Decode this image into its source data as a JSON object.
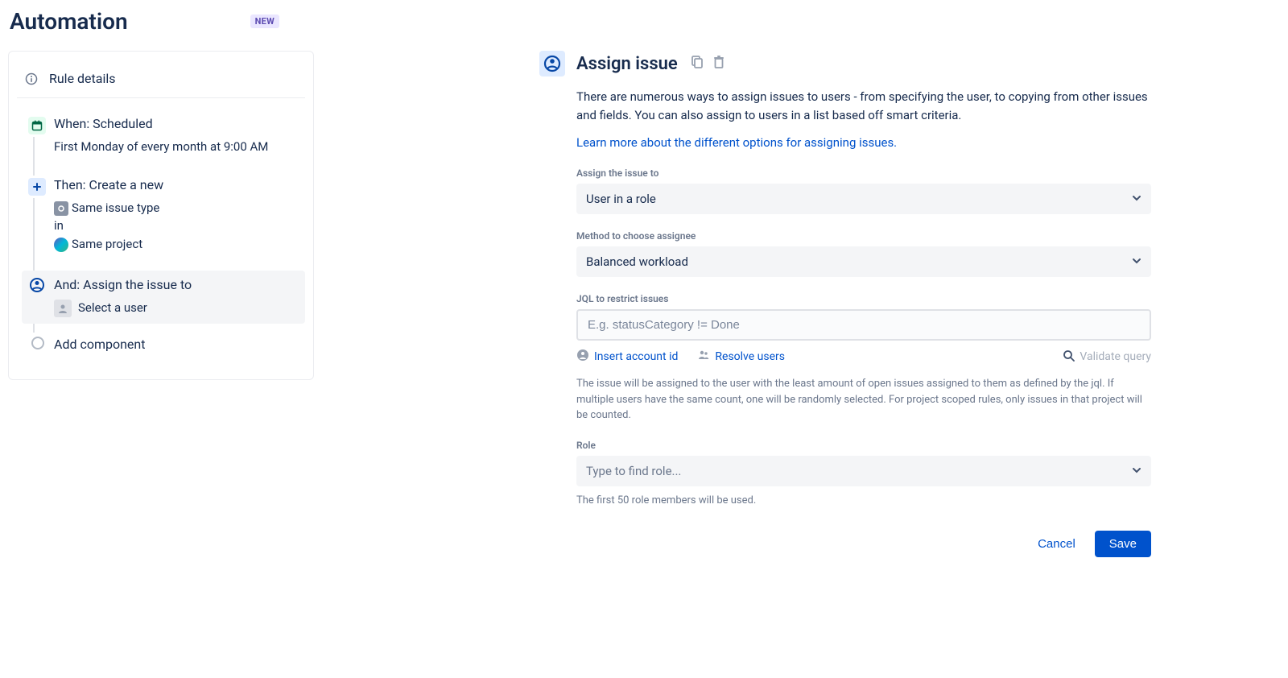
{
  "header": {
    "title": "Automation",
    "badge": "NEW"
  },
  "sidebar": {
    "rule_details": "Rule details",
    "trigger": {
      "title": "When: Scheduled",
      "subtitle": "First Monday of every month at 9:00 AM"
    },
    "action_create": {
      "title": "Then: Create a new",
      "line1": "Same issue type",
      "line2": "in",
      "line3": "Same project"
    },
    "action_assign": {
      "title": "And: Assign the issue to",
      "subtitle": "Select a user"
    },
    "add_component": "Add component"
  },
  "panel": {
    "title": "Assign issue",
    "description": "There are numerous ways to assign issues to users - from specifying the user, to copying from other issues and fields. You can also assign to users in a list based off smart criteria.",
    "learn_more": "Learn more about the different options for assigning issues.",
    "assign_label": "Assign the issue to",
    "assign_value": "User in a role",
    "method_label": "Method to choose assignee",
    "method_value": "Balanced workload",
    "jql_label": "JQL to restrict issues",
    "jql_placeholder": "E.g. statusCategory != Done",
    "insert_account": "Insert account id",
    "resolve_users": "Resolve users",
    "validate_query": "Validate query",
    "jql_help": "The issue will be assigned to the user with the least amount of open issues assigned to them as defined by the jql. If multiple users have the same count, one will be randomly selected. For project scoped rules, only issues in that project will be counted.",
    "role_label": "Role",
    "role_placeholder": "Type to find role...",
    "role_help": "The first 50 role members will be used.",
    "cancel": "Cancel",
    "save": "Save"
  }
}
